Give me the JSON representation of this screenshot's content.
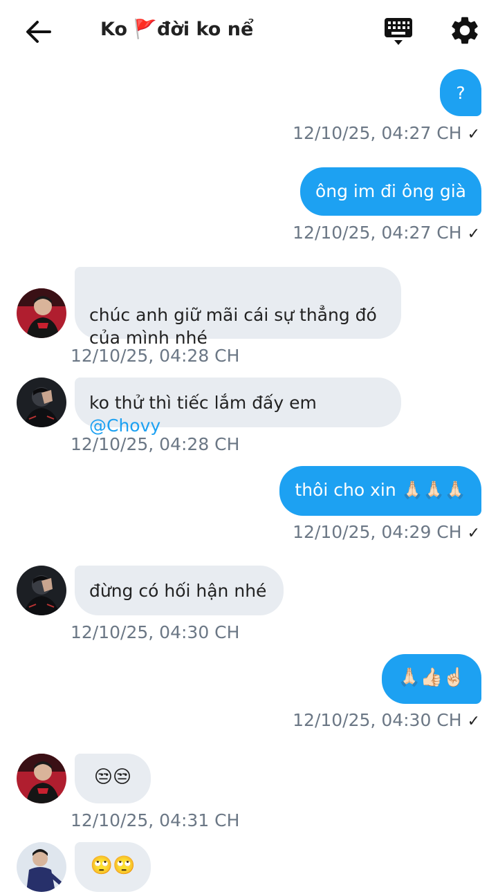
{
  "header": {
    "title": "Ko 🚩đời ko nể",
    "back_icon": "arrow-left-icon",
    "keyboard_icon": "keyboard-icon",
    "settings_icon": "gear-icon"
  },
  "colors": {
    "outgoing": "#1da1f2",
    "incoming": "#e8ecf1",
    "timestamp": "#6b7785",
    "mention": "#1da1f2"
  },
  "messages": [
    {
      "dir": "out",
      "text": "?",
      "time": "12/10/25, 04:27 CH",
      "status": "✓"
    },
    {
      "dir": "out",
      "text": "ông im đi ông già",
      "time": "12/10/25, 04:27 CH",
      "status": "✓"
    },
    {
      "dir": "in",
      "text": "chúc anh giữ mãi cái sự thẳng đó\ncủa mình nhé",
      "time": "12/10/25, 04:28 CH",
      "avatar": "red-jersey"
    },
    {
      "dir": "in",
      "text": "ko thử thì tiếc lắm đấy em ",
      "mention": "@Chovy",
      "time": "12/10/25, 04:28 CH",
      "avatar": "dark-hand"
    },
    {
      "dir": "out",
      "text": "thôi cho xin 🙏🏻🙏🏻🙏🏻",
      "time": "12/10/25, 04:29 CH",
      "status": "✓"
    },
    {
      "dir": "in",
      "text": "đừng có hối hận nhé",
      "time": "12/10/25, 04:30 CH",
      "avatar": "dark-hand"
    },
    {
      "dir": "out",
      "text": "🙏🏻👍🏻☝🏻",
      "time": "12/10/25, 04:30 CH",
      "status": "✓"
    },
    {
      "dir": "in",
      "text": "😒😒",
      "time": "12/10/25, 04:31 CH",
      "avatar": "red-jersey"
    },
    {
      "dir": "in",
      "text": "🙄🙄",
      "avatar": "blue-suit"
    }
  ]
}
